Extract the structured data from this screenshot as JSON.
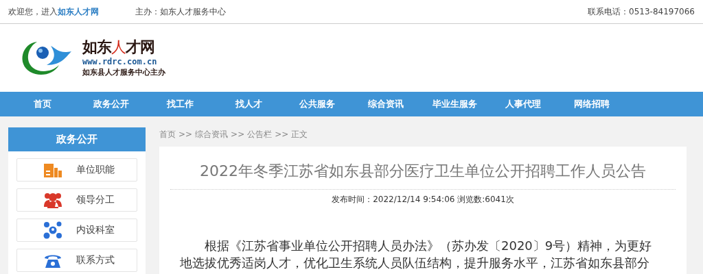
{
  "top_bar": {
    "welcome": "欢迎您，进入",
    "site_link": "如东人才网",
    "host": "主办：如东人才服务中心",
    "phone": "联系电话：0513-84197066"
  },
  "logo": {
    "title_parts": [
      {
        "text": "如东",
        "accent": false
      },
      {
        "text": "人",
        "accent": true
      },
      {
        "text": "才网",
        "accent": false
      }
    ],
    "url": "www.rdrc.com.cn",
    "subtitle": "如东县人才服务中心主办"
  },
  "nav": [
    {
      "label": "首页"
    },
    {
      "label": "政务公开"
    },
    {
      "label": "找工作"
    },
    {
      "label": "找人才"
    },
    {
      "label": "公共服务"
    },
    {
      "label": "综合资讯"
    },
    {
      "label": "毕业生服务"
    },
    {
      "label": "人事代理"
    },
    {
      "label": "网络招聘"
    }
  ],
  "sidebar": {
    "title": "政务公开",
    "items": [
      {
        "label": "单位职能"
      },
      {
        "label": "领导分工"
      },
      {
        "label": "内设科室"
      },
      {
        "label": "联系方式"
      }
    ]
  },
  "breadcrumb": [
    "首页",
    ">>",
    "综合资讯",
    ">>",
    "公告栏",
    ">>",
    "正文"
  ],
  "article": {
    "title": "2022年冬季江苏省如东县部分医疗卫生单位公开招聘工作人员公告",
    "meta": "发布时间：2022/12/14 9:54:06 浏览数:6041次",
    "body_lines": [
      "根据《江苏省事业单位公开招聘人员办法》（苏办发〔2020〕9号）精神，为更好",
      "地选拔优秀适岗人才，优化卫生系统人员队伍结构，提升服务水平，江苏省如东县部分"
    ]
  }
}
